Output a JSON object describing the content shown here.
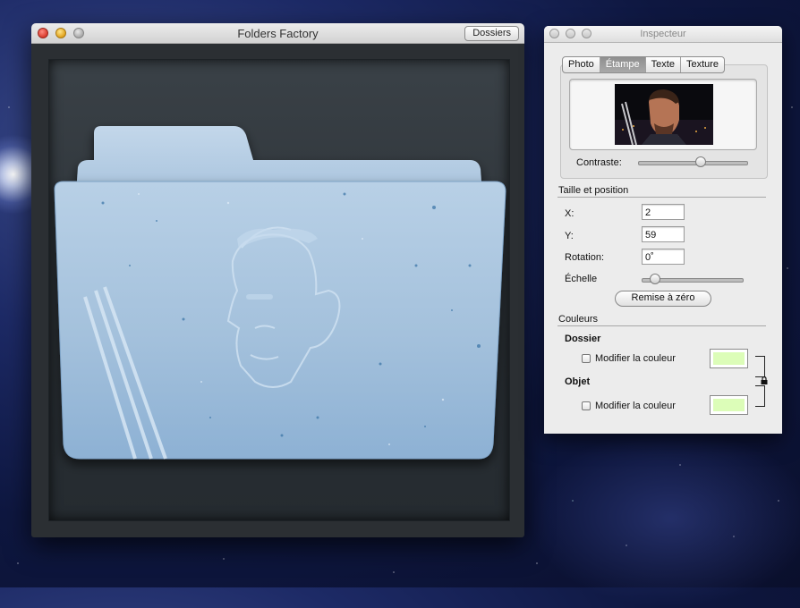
{
  "main_window": {
    "title": "Folders Factory",
    "toolbar_button_label": "Dossiers"
  },
  "inspector": {
    "title": "Inspecteur",
    "tabs": [
      {
        "label": "Photo",
        "active": false
      },
      {
        "label": "Étampe",
        "active": true
      },
      {
        "label": "Texte",
        "active": false
      },
      {
        "label": "Texture",
        "active": false
      }
    ],
    "contrast_label": "Contraste:",
    "contrast_value": 0.58,
    "size_section": {
      "title": "Taille et position",
      "x_label": "X:",
      "x_value": "2",
      "y_label": "Y:",
      "y_value": "59",
      "rotation_label": "Rotation:",
      "rotation_value": "0˚",
      "scale_label": "Échelle",
      "scale_value": 0.08,
      "reset_button": "Remise à zéro"
    },
    "colors_section": {
      "title": "Couleurs",
      "folder_heading": "Dossier",
      "folder_checkbox_label": "Modifier la couleur",
      "folder_checked": false,
      "folder_color": "#dcfdb8",
      "object_heading": "Objet",
      "object_checkbox_label": "Modifier la couleur",
      "object_checked": false,
      "object_color": "#dcfdb8"
    }
  },
  "colors": {
    "folder_blue": "#9ec1de",
    "canvas_dark": "#2e3439"
  }
}
